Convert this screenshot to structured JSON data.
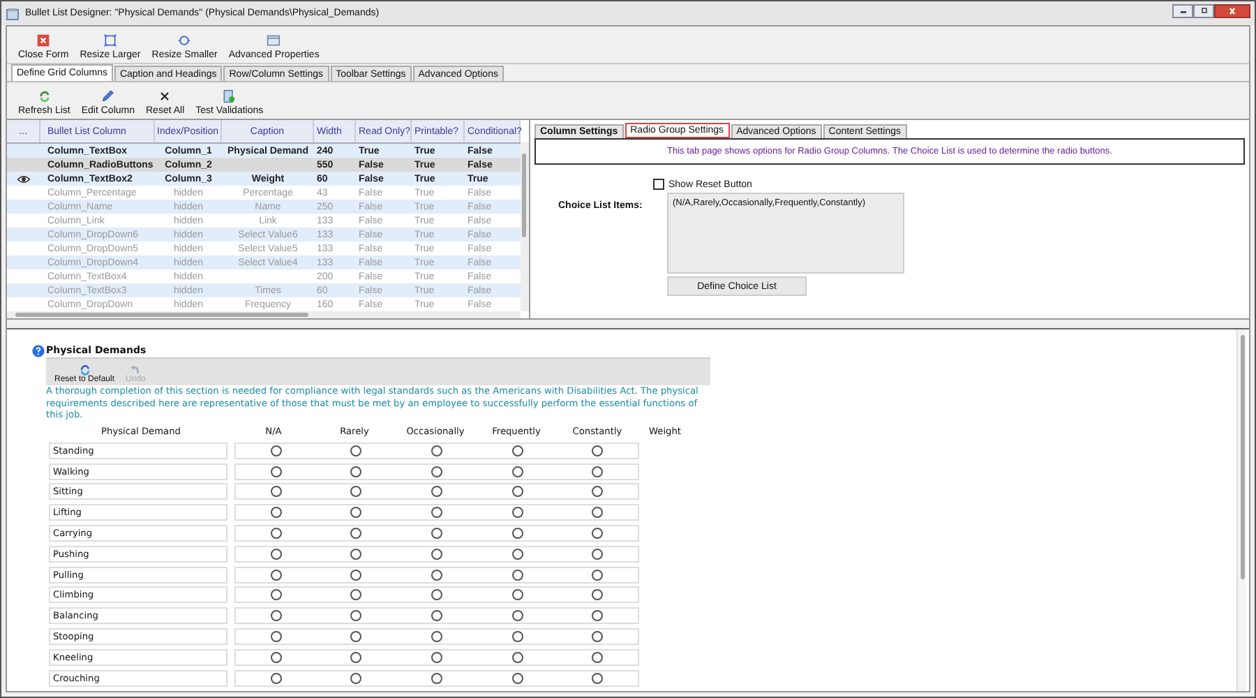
{
  "window": {
    "title": "Bullet List Designer: \"Physical Demands\" (Physical Demands\\Physical_Demands)"
  },
  "toolbar": [
    {
      "label": "Close Form",
      "kind": "close"
    },
    {
      "label": "Resize Larger",
      "kind": "larger"
    },
    {
      "label": "Resize Smaller",
      "kind": "smaller"
    },
    {
      "label": "Advanced Properties",
      "kind": "properties"
    }
  ],
  "tabs": [
    {
      "label": "Define Grid Columns",
      "selected": true
    },
    {
      "label": "Caption and Headings",
      "selected": false
    },
    {
      "label": "Row/Column Settings",
      "selected": false
    },
    {
      "label": "Toolbar Settings",
      "selected": false
    },
    {
      "label": "Advanced Options",
      "selected": false
    }
  ],
  "grid_toolbar": [
    {
      "label": "Refresh List",
      "kind": "refresh"
    },
    {
      "label": "Edit Column",
      "kind": "edit"
    },
    {
      "label": "Reset All",
      "kind": "reset"
    },
    {
      "label": "Test Validations",
      "kind": "test"
    }
  ],
  "grid": {
    "columns": [
      "...",
      "Bullet List Column",
      "Index/Position",
      "Caption",
      "Width",
      "Read Only?",
      "Printable?",
      "Conditional?"
    ],
    "rows": [
      {
        "cells": [
          "",
          "Column_TextBox",
          "Column_1",
          "Physical Demand",
          "240",
          "True",
          "True",
          "False"
        ],
        "visible": true,
        "selected": false,
        "marker": false
      },
      {
        "cells": [
          "",
          "Column_RadioButtons",
          "Column_2",
          "",
          "550",
          "False",
          "True",
          "False"
        ],
        "visible": true,
        "selected": true,
        "marker": false
      },
      {
        "cells": [
          "",
          "Column_TextBox2",
          "Column_3",
          "Weight",
          "60",
          "False",
          "True",
          "True"
        ],
        "visible": true,
        "selected": false,
        "marker": true
      },
      {
        "cells": [
          "",
          "Column_Percentage",
          "hidden",
          "Percentage",
          "43",
          "False",
          "True",
          "False"
        ],
        "visible": false,
        "selected": false,
        "marker": false
      },
      {
        "cells": [
          "",
          "Column_Name",
          "hidden",
          "Name",
          "250",
          "False",
          "True",
          "False"
        ],
        "visible": false,
        "selected": false,
        "marker": false
      },
      {
        "cells": [
          "",
          "Column_Link",
          "hidden",
          "Link",
          "133",
          "False",
          "True",
          "False"
        ],
        "visible": false,
        "selected": false,
        "marker": false
      },
      {
        "cells": [
          "",
          "Column_DropDown6",
          "hidden",
          "Select Value6",
          "133",
          "False",
          "True",
          "False"
        ],
        "visible": false,
        "selected": false,
        "marker": false
      },
      {
        "cells": [
          "",
          "Column_DropDown5",
          "hidden",
          "Select Value5",
          "133",
          "False",
          "True",
          "False"
        ],
        "visible": false,
        "selected": false,
        "marker": false
      },
      {
        "cells": [
          "",
          "Column_DropDown4",
          "hidden",
          "Select Value4",
          "133",
          "False",
          "True",
          "False"
        ],
        "visible": false,
        "selected": false,
        "marker": false
      },
      {
        "cells": [
          "",
          "Column_TextBox4",
          "hidden",
          "",
          "200",
          "False",
          "True",
          "False"
        ],
        "visible": false,
        "selected": false,
        "marker": false
      },
      {
        "cells": [
          "",
          "Column_TextBox3",
          "hidden",
          "Times",
          "60",
          "False",
          "True",
          "False"
        ],
        "visible": false,
        "selected": false,
        "marker": false
      },
      {
        "cells": [
          "",
          "Column_DropDown",
          "hidden",
          "Frequency",
          "160",
          "False",
          "True",
          "False"
        ],
        "visible": false,
        "selected": false,
        "marker": false
      }
    ]
  },
  "settings_tabs": [
    {
      "label": "Column Settings",
      "selected": false
    },
    {
      "label": "Radio Group Settings",
      "selected": true
    },
    {
      "label": "Advanced Options",
      "selected": false
    },
    {
      "label": "Content Settings",
      "selected": false
    }
  ],
  "settings": {
    "info": "This tab page shows options for Radio Group Columns. The Choice List is used to determine the radio buttons.",
    "show_reset": {
      "label": "Show Reset Button",
      "checked": false
    },
    "choice_label": "Choice List Items:",
    "choice_value": "(N/A,Rarely,Occasionally,Frequently,Constantly)",
    "button": "Define Choice List"
  },
  "preview": {
    "title": "Physical Demands",
    "toolbar": [
      {
        "label": "Reset to Default",
        "kind": "reset",
        "disabled": false
      },
      {
        "label": "Undo",
        "kind": "undo",
        "disabled": true
      }
    ],
    "description": "A thorough completion of this section is needed for compliance with legal standards such as the Americans with Disabilities Act. The physical requirements described here are representative of those that must be met by an employee to successfully perform the essential functions of this job.",
    "label_heading": "Physical Demand",
    "choices": [
      "N/A",
      "Rarely",
      "Occasionally",
      "Frequently",
      "Constantly"
    ],
    "weight_heading": "Weight",
    "rows": [
      {
        "label": "Standing",
        "checked": [
          false,
          false,
          false,
          false,
          false
        ]
      },
      {
        "label": "Walking",
        "checked": [
          false,
          false,
          false,
          false,
          false
        ]
      },
      {
        "label": "Sitting",
        "checked": [
          false,
          false,
          false,
          false,
          false
        ]
      },
      {
        "label": "Lifting",
        "checked": [
          false,
          false,
          false,
          false,
          false
        ]
      },
      {
        "label": "Carrying",
        "checked": [
          false,
          false,
          false,
          false,
          false
        ]
      },
      {
        "label": "Pushing",
        "checked": [
          false,
          false,
          false,
          false,
          false
        ]
      },
      {
        "label": "Pulling",
        "checked": [
          false,
          false,
          false,
          false,
          false
        ]
      },
      {
        "label": "Climbing",
        "checked": [
          false,
          false,
          false,
          false,
          false
        ]
      },
      {
        "label": "Balancing",
        "checked": [
          false,
          false,
          false,
          false,
          false
        ]
      },
      {
        "label": "Stooping",
        "checked": [
          false,
          false,
          false,
          false,
          false
        ]
      },
      {
        "label": "Kneeling",
        "checked": [
          false,
          false,
          false,
          false,
          false
        ]
      },
      {
        "label": "Crouching",
        "checked": [
          false,
          false,
          false,
          false,
          false
        ]
      }
    ]
  }
}
